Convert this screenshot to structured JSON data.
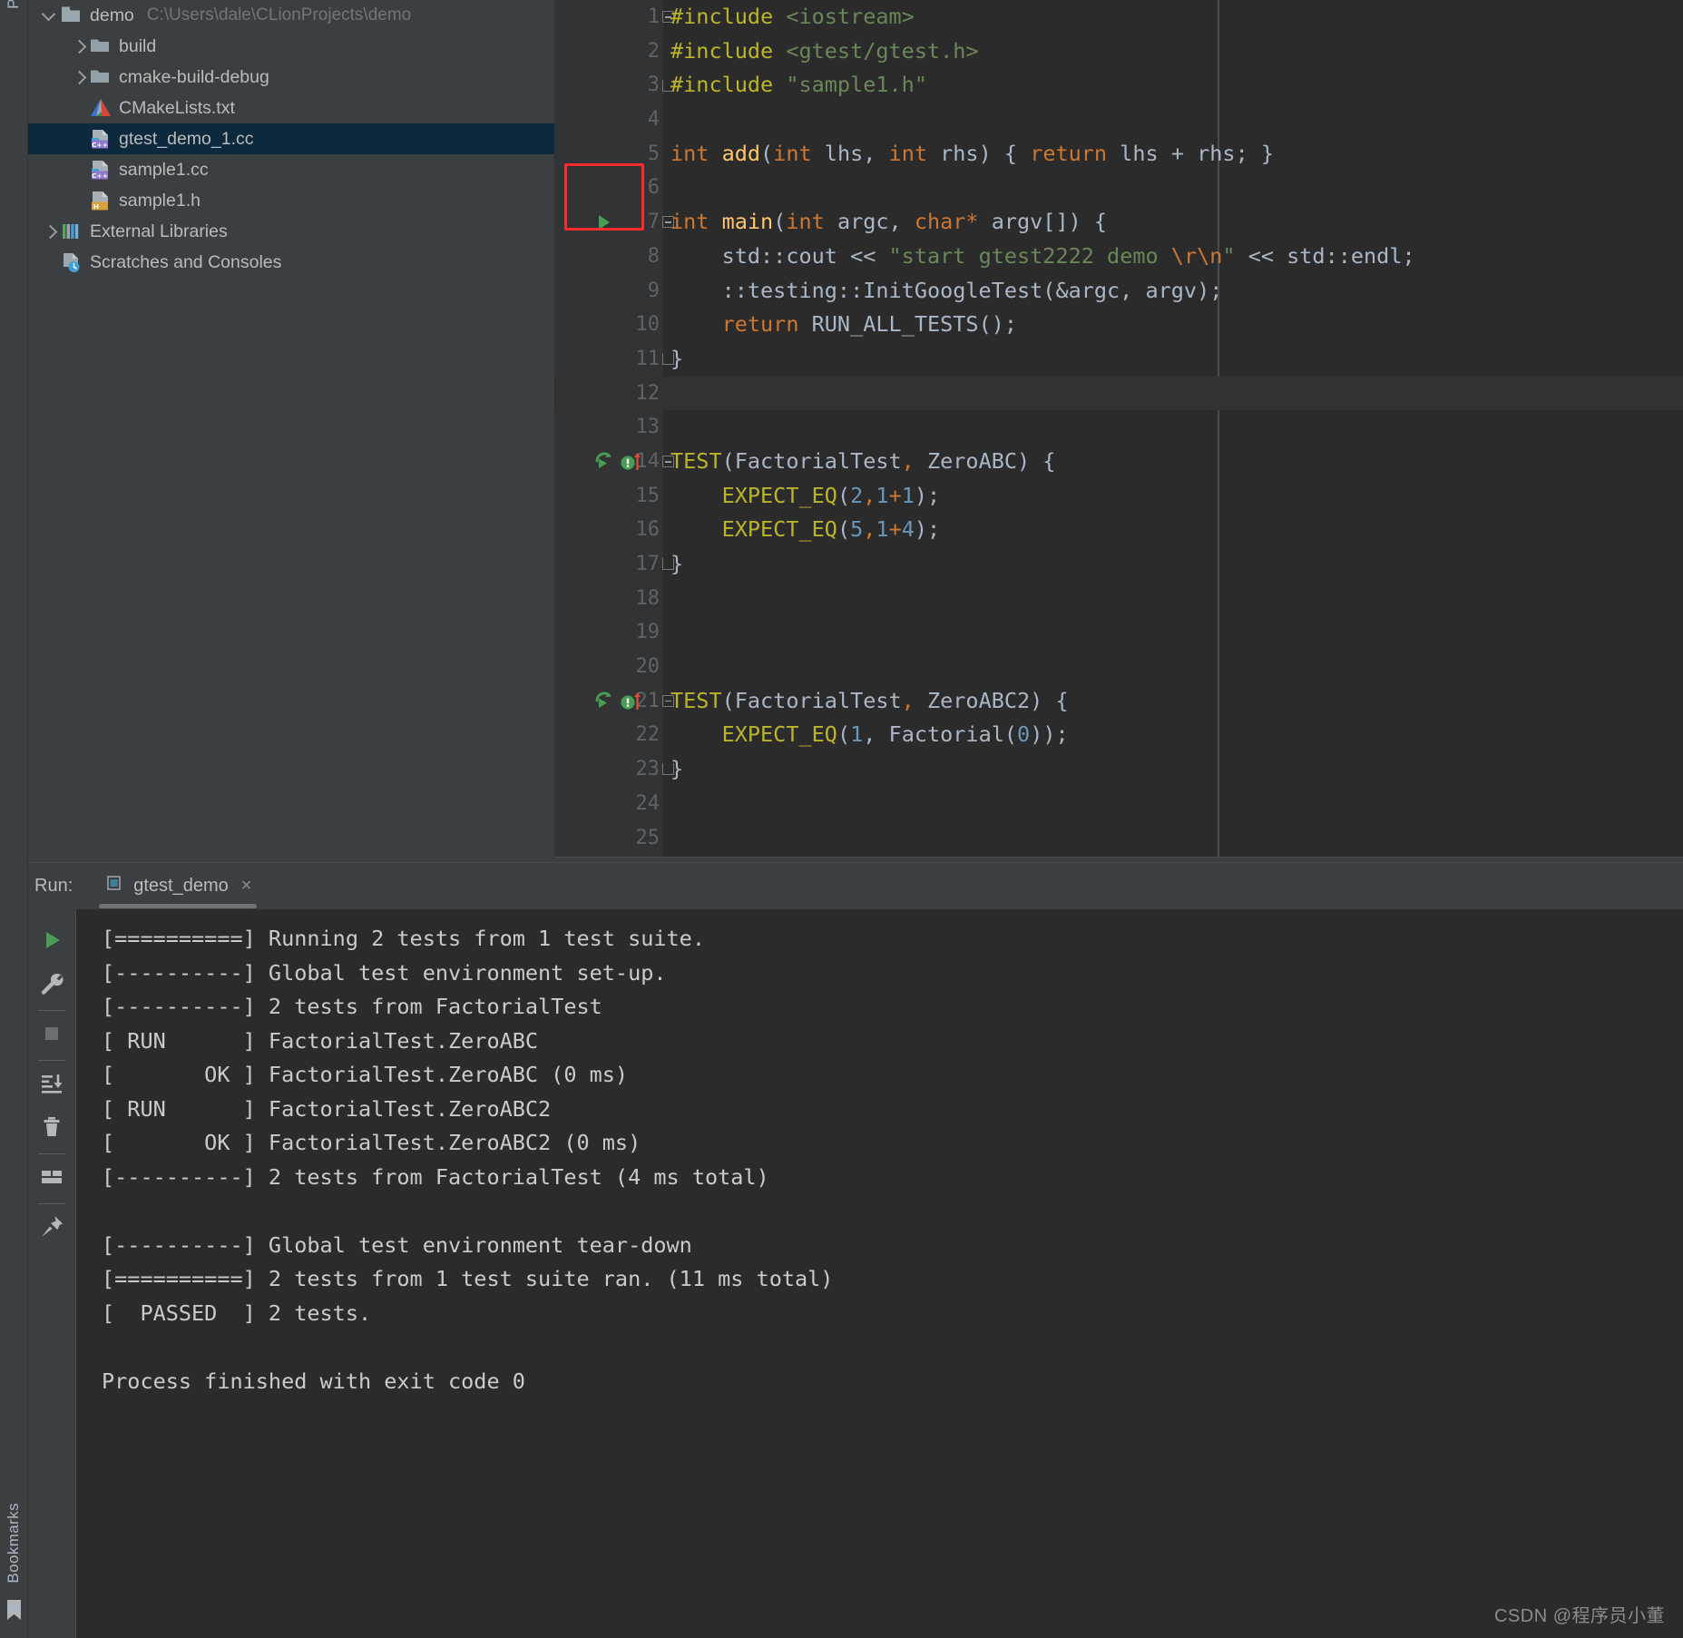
{
  "left_strip": {
    "project_label": "Pr",
    "bookmarks_label": "Bookmarks",
    "bookmark_icon": "bookmark-icon"
  },
  "project_tree": {
    "items": [
      {
        "label": "demo",
        "path_hint": "C:\\Users\\dale\\CLionProjects\\demo",
        "icon": "folder-module-icon",
        "arrow": "expanded",
        "indent": 0,
        "selected": false
      },
      {
        "label": "build",
        "path_hint": "",
        "icon": "folder-icon",
        "arrow": "collapsed",
        "indent": 1,
        "selected": false
      },
      {
        "label": "cmake-build-debug",
        "path_hint": "",
        "icon": "folder-icon",
        "arrow": "collapsed",
        "indent": 1,
        "selected": false
      },
      {
        "label": "CMakeLists.txt",
        "path_hint": "",
        "icon": "cmake-file-icon",
        "arrow": "none",
        "indent": 1,
        "selected": false
      },
      {
        "label": "gtest_demo_1.cc",
        "path_hint": "",
        "icon": "cpp-file-icon",
        "arrow": "none",
        "indent": 1,
        "selected": true
      },
      {
        "label": "sample1.cc",
        "path_hint": "",
        "icon": "cpp-file-icon",
        "arrow": "none",
        "indent": 1,
        "selected": false
      },
      {
        "label": "sample1.h",
        "path_hint": "",
        "icon": "header-file-icon",
        "arrow": "none",
        "indent": 1,
        "selected": false
      },
      {
        "label": "External Libraries",
        "path_hint": "",
        "icon": "libraries-icon",
        "arrow": "collapsed",
        "indent": 0,
        "selected": false
      },
      {
        "label": "Scratches and Consoles",
        "path_hint": "",
        "icon": "scratches-icon",
        "arrow": "none",
        "indent": 0,
        "selected": false
      }
    ]
  },
  "editor": {
    "highlight_box": {
      "name": "run-gutter-highlight",
      "color": "#ff2b2b"
    },
    "current_line": 12,
    "lines": [
      {
        "no": 1,
        "fold": "start",
        "gutter": [],
        "tokens": [
          {
            "t": "#include ",
            "c": "pp"
          },
          {
            "t": "<iostream>",
            "c": "hdr"
          }
        ]
      },
      {
        "no": 2,
        "fold": "",
        "gutter": [],
        "tokens": [
          {
            "t": "#include ",
            "c": "pp"
          },
          {
            "t": "<gtest/gtest.h>",
            "c": "hdr"
          }
        ]
      },
      {
        "no": 3,
        "fold": "end",
        "gutter": [],
        "tokens": [
          {
            "t": "#include ",
            "c": "pp"
          },
          {
            "t": "\"sample1.h\"",
            "c": "hdr"
          }
        ]
      },
      {
        "no": 4,
        "fold": "",
        "gutter": [],
        "tokens": []
      },
      {
        "no": 5,
        "fold": "",
        "gutter": [],
        "tokens": [
          {
            "t": "int ",
            "c": "kw"
          },
          {
            "t": "add",
            "c": "fn"
          },
          {
            "t": "(",
            "c": "pl"
          },
          {
            "t": "int ",
            "c": "kw"
          },
          {
            "t": "lhs",
            "c": "pl"
          },
          {
            "t": ", ",
            "c": "pl"
          },
          {
            "t": "int ",
            "c": "kw"
          },
          {
            "t": "rhs",
            "c": "pl"
          },
          {
            "t": ") { ",
            "c": "pl"
          },
          {
            "t": "return ",
            "c": "kw"
          },
          {
            "t": "lhs + rhs; }",
            "c": "pl"
          }
        ]
      },
      {
        "no": 6,
        "fold": "",
        "gutter": [],
        "tokens": []
      },
      {
        "no": 7,
        "fold": "start",
        "gutter": [
          "run-play-icon"
        ],
        "tokens": [
          {
            "t": "int ",
            "c": "kw"
          },
          {
            "t": "main",
            "c": "fn"
          },
          {
            "t": "(",
            "c": "pl"
          },
          {
            "t": "int ",
            "c": "kw"
          },
          {
            "t": "argc",
            "c": "pl"
          },
          {
            "t": ", ",
            "c": "pl"
          },
          {
            "t": "char",
            "c": "kw"
          },
          {
            "t": "* ",
            "c": "kw"
          },
          {
            "t": "argv[]) {",
            "c": "pl"
          }
        ]
      },
      {
        "no": 8,
        "fold": "",
        "gutter": [],
        "tokens": [
          {
            "t": "    std::cout ",
            "c": "pl"
          },
          {
            "t": "<< ",
            "c": "op"
          },
          {
            "t": "\"start gtest2222 demo ",
            "c": "str"
          },
          {
            "t": "\\r\\n",
            "c": "esc"
          },
          {
            "t": "\"",
            "c": "str"
          },
          {
            "t": " << std::endl;",
            "c": "pl"
          }
        ]
      },
      {
        "no": 9,
        "fold": "",
        "gutter": [],
        "tokens": [
          {
            "t": "    ::testing::InitGoogleTest(&argc, argv);",
            "c": "pl"
          }
        ]
      },
      {
        "no": 10,
        "fold": "",
        "gutter": [],
        "tokens": [
          {
            "t": "    ",
            "c": "pl"
          },
          {
            "t": "return ",
            "c": "kw"
          },
          {
            "t": "RUN_ALL_TESTS();",
            "c": "pl"
          }
        ]
      },
      {
        "no": 11,
        "fold": "end",
        "gutter": [],
        "tokens": [
          {
            "t": "}",
            "c": "pl"
          }
        ]
      },
      {
        "no": 12,
        "fold": "",
        "gutter": [],
        "tokens": []
      },
      {
        "no": 13,
        "fold": "",
        "gutter": [],
        "tokens": []
      },
      {
        "no": 14,
        "fold": "start",
        "gutter": [
          "rerun-test-icon",
          "test-passed-icon"
        ],
        "tokens": [
          {
            "t": "TEST",
            "c": "mac"
          },
          {
            "t": "(FactorialTest",
            "c": "pl"
          },
          {
            "t": ",",
            "c": "kw"
          },
          {
            "t": " ZeroABC) {",
            "c": "pl"
          }
        ]
      },
      {
        "no": 15,
        "fold": "",
        "gutter": [],
        "tokens": [
          {
            "t": "    ",
            "c": "pl"
          },
          {
            "t": "EXPECT_EQ",
            "c": "mac"
          },
          {
            "t": "(",
            "c": "pl"
          },
          {
            "t": "2",
            "c": "num"
          },
          {
            "t": ",",
            "c": "kw"
          },
          {
            "t": "1",
            "c": "num"
          },
          {
            "t": "+",
            "c": "kw"
          },
          {
            "t": "1",
            "c": "num"
          },
          {
            "t": ");",
            "c": "pl"
          }
        ]
      },
      {
        "no": 16,
        "fold": "",
        "gutter": [],
        "tokens": [
          {
            "t": "    ",
            "c": "pl"
          },
          {
            "t": "EXPECT_EQ",
            "c": "mac"
          },
          {
            "t": "(",
            "c": "pl"
          },
          {
            "t": "5",
            "c": "num"
          },
          {
            "t": ",",
            "c": "kw"
          },
          {
            "t": "1",
            "c": "num"
          },
          {
            "t": "+",
            "c": "kw"
          },
          {
            "t": "4",
            "c": "num"
          },
          {
            "t": ");",
            "c": "pl"
          }
        ]
      },
      {
        "no": 17,
        "fold": "end",
        "gutter": [],
        "tokens": [
          {
            "t": "}",
            "c": "pl"
          }
        ]
      },
      {
        "no": 18,
        "fold": "",
        "gutter": [],
        "tokens": []
      },
      {
        "no": 19,
        "fold": "",
        "gutter": [],
        "tokens": []
      },
      {
        "no": 20,
        "fold": "",
        "gutter": [],
        "tokens": []
      },
      {
        "no": 21,
        "fold": "start",
        "gutter": [
          "rerun-test-icon",
          "test-passed-icon"
        ],
        "tokens": [
          {
            "t": "TEST",
            "c": "mac"
          },
          {
            "t": "(FactorialTest",
            "c": "pl"
          },
          {
            "t": ",",
            "c": "kw"
          },
          {
            "t": " ZeroABC2) {",
            "c": "pl"
          }
        ]
      },
      {
        "no": 22,
        "fold": "",
        "gutter": [],
        "tokens": [
          {
            "t": "    ",
            "c": "pl"
          },
          {
            "t": "EXPECT_EQ",
            "c": "mac"
          },
          {
            "t": "(",
            "c": "pl"
          },
          {
            "t": "1",
            "c": "num"
          },
          {
            "t": ", Factorial(",
            "c": "pl"
          },
          {
            "t": "0",
            "c": "num"
          },
          {
            "t": "));",
            "c": "pl"
          }
        ]
      },
      {
        "no": 23,
        "fold": "end",
        "gutter": [],
        "tokens": [
          {
            "t": "}",
            "c": "pl"
          }
        ]
      },
      {
        "no": 24,
        "fold": "",
        "gutter": [],
        "tokens": []
      },
      {
        "no": 25,
        "fold": "",
        "gutter": [],
        "tokens": []
      }
    ]
  },
  "run_panel": {
    "label": "Run:",
    "tab": {
      "name": "gtest_demo",
      "icon": "run-config-icon",
      "close": "×"
    },
    "toolbar": [
      {
        "icon": "rerun-play-icon",
        "sep_after": false
      },
      {
        "icon": "wrench-settings-icon",
        "sep_after": true
      },
      {
        "icon": "stop-icon",
        "sep_after": true
      },
      {
        "icon": "scroll-to-end-icon",
        "sep_after": false
      },
      {
        "icon": "trash-icon",
        "sep_after": true
      },
      {
        "icon": "soft-wrap-icon",
        "sep_after": true
      },
      {
        "icon": "pin-tab-icon",
        "sep_after": false
      }
    ],
    "console_lines": [
      "[==========] Running 2 tests from 1 test suite.",
      "[----------] Global test environment set-up.",
      "[----------] 2 tests from FactorialTest",
      "[ RUN      ] FactorialTest.ZeroABC",
      "[       OK ] FactorialTest.ZeroABC (0 ms)",
      "[ RUN      ] FactorialTest.ZeroABC2",
      "[       OK ] FactorialTest.ZeroABC2 (0 ms)",
      "[----------] 2 tests from FactorialTest (4 ms total)",
      "",
      "[----------] Global test environment tear-down",
      "[==========] 2 tests from 1 test suite ran. (11 ms total)",
      "[  PASSED  ] 2 tests.",
      "",
      "Process finished with exit code 0"
    ]
  },
  "watermark": "CSDN @程序员小董",
  "colors": {
    "accent_green": "#499c54",
    "selection_blue": "#0d293e",
    "editor_bg": "#2b2b2b",
    "panel_bg": "#3c3f41",
    "highlight_red": "#ff2b2b"
  }
}
